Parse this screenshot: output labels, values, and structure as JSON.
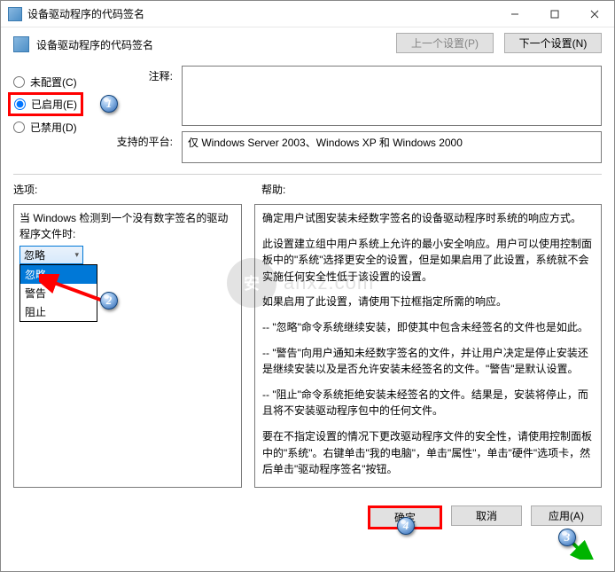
{
  "title": "设备驱动程序的代码签名",
  "header": "设备驱动程序的代码签名",
  "nav": {
    "prev": "上一个设置(P)",
    "next": "下一个设置(N)"
  },
  "radios": {
    "unconfigured": "未配置(C)",
    "enabled": "已启用(E)",
    "disabled": "已禁用(D)"
  },
  "fields": {
    "comment_label": "注释:",
    "platform_label": "支持的平台:",
    "platform_value": "仅 Windows Server 2003、Windows XP 和 Windows 2000"
  },
  "labels": {
    "options": "选项:",
    "help": "帮助:"
  },
  "left": {
    "text": "当 Windows 检测到一个没有数字签名的驱动程序文件时:",
    "selected": "忽略",
    "options": [
      "忽略",
      "警告",
      "阻止"
    ]
  },
  "help": {
    "p1": "确定用户试图安装未经数字签名的设备驱动程序时系统的响应方式。",
    "p2": "此设置建立组中用户系统上允许的最小安全响应。用户可以使用控制面板中的\"系统\"选择更安全的设置，但是如果启用了此设置，系统就不会实施任何安全性低于该设置的设置。",
    "p3": "如果启用了此设置，请使用下拉框指定所需的响应。",
    "p4": "-- \"忽略\"命令系统继续安装，即使其中包含未经签名的文件也是如此。",
    "p5": "-- \"警告\"向用户通知未经数字签名的文件，并让用户决定是停止安装还是继续安装以及是否允许安装未经签名的文件。\"警告\"是默认设置。",
    "p6": "-- \"阻止\"命令系统拒绝安装未经签名的文件。结果是，安装将停止，而且将不安装驱动程序包中的任何文件。",
    "p7": "要在不指定设置的情况下更改驱动程序文件的安全性，请使用控制面板中的\"系统\"。右键单击\"我的电脑\"，单击\"属性\"，单击\"硬件\"选项卡，然后单击\"驱动程序签名\"按钮。"
  },
  "buttons": {
    "ok": "确定",
    "cancel": "取消",
    "apply": "应用(A)"
  },
  "annotations": {
    "a1": "1",
    "a2": "2",
    "a3": "3",
    "a4": "4"
  },
  "watermark": {
    "icon": "安",
    "text": "anxz.com"
  }
}
